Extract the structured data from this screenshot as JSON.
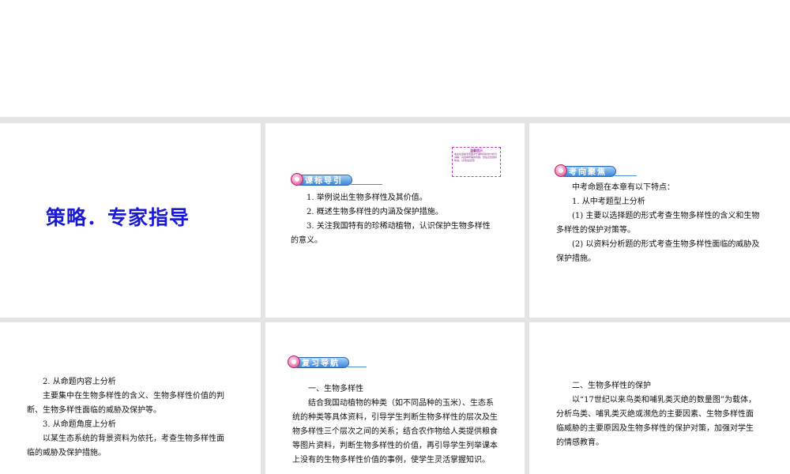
{
  "slide1": {
    "title": "策略．专家指导"
  },
  "slide2": {
    "tag": "课标导引",
    "note": {
      "title": "温馨提示",
      "body": "本文总选编专家团对于课时目标的分析与讲解，请选择所需的内容，然后点击鼠标前进。(点击后出现)"
    },
    "lines": [
      "1. 举例说出生物多样性及其价值。",
      "2. 概述生物多样性的内涵及保护措施。",
      "3. 关注我国特有的珍稀动植物，认识保护生物多样性",
      "的意义。"
    ]
  },
  "slide3": {
    "tag": "考向聚焦",
    "lines": [
      "中考命题在本章有以下特点：",
      "1. 从中考题型上分析",
      "(1) 主要以选择题的形式考查生物多样性的含义和生物",
      "多样性的保护对策等。",
      "(2) 以资料分析题的形式考查生物多样性面临的威胁及",
      "保护措施。"
    ]
  },
  "slide4": {
    "lines": [
      "2. 从命题内容上分析",
      "主要集中在生物多样性的含义、生物多样性价值的判",
      "断、生物多样性面临的威胁及保护等。",
      "3. 从命题角度上分析",
      "以某生态系统的背景资料为依托，考查生物多样性面",
      "临的威胁及保护措施。"
    ]
  },
  "slide5": {
    "tag": "复习导航",
    "lines": [
      "一、生物多样性",
      "结合我国动植物的种类（如不同品种的玉米）、生态系",
      "统的种类等具体资料，引导学生判断生物多样性的层次及生",
      "物多样性三个层次之间的关系；结合农作物给人类提供粮食",
      "等图片资料，判断生物多样性的价值，再引导学生列举课本",
      "上没有的生物多样性价值的事例，使学生灵活掌握知识。"
    ]
  },
  "slide6": {
    "lines": [
      "二、生物多样性的保护",
      "以“17世纪以来鸟类和哺乳类灭绝的数量图”为载体，",
      "分析鸟类、哺乳类灭绝或濒危的主要因素、生物多样性面",
      "临威胁的主要原因及生物多样性的保护对策，加强对学生",
      "的情感教育。"
    ]
  }
}
